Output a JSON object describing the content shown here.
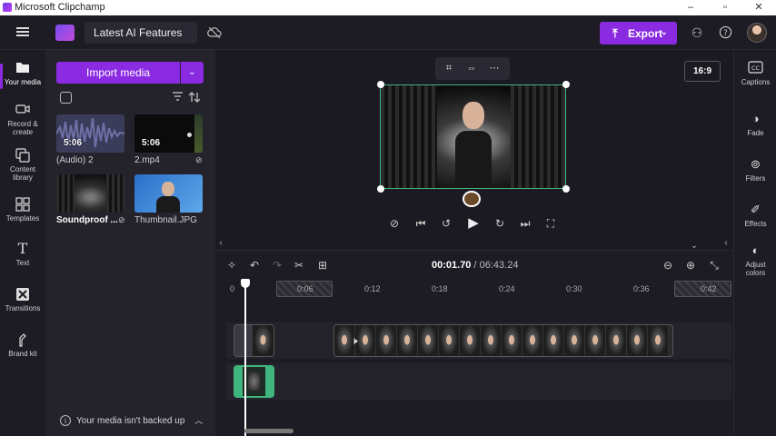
{
  "window": {
    "title": "Microsoft Clipchamp",
    "minimize": "‒",
    "maximize": "▫",
    "close": "✕"
  },
  "header": {
    "project_name": "Latest AI Features",
    "export_label": "Export",
    "export_chevron": "⌄",
    "icons": [
      "menu-icon",
      "cloud-off-icon",
      "upload-icon",
      "share-people-icon",
      "help-icon"
    ]
  },
  "leftnav": [
    {
      "label": "Your media",
      "icon": "folder-icon"
    },
    {
      "label": "Record & create",
      "icon": "camera-icon"
    },
    {
      "label": "Content library",
      "icon": "library-icon"
    },
    {
      "label": "Templates",
      "icon": "templates-icon"
    },
    {
      "label": "Text",
      "icon": "text-icon"
    },
    {
      "label": "Transitions",
      "icon": "transitions-icon"
    },
    {
      "label": "Brand kit",
      "icon": "brand-kit-icon"
    }
  ],
  "media": {
    "import_label": "Import media",
    "items": [
      {
        "name": "(Audio) 2",
        "duration": "5:06"
      },
      {
        "name": "2.mp4",
        "duration": "5:06"
      },
      {
        "name": "Soundproof ...",
        "duration": ""
      },
      {
        "name": "Thumbnail.JPG",
        "duration": ""
      }
    ],
    "backup_text": "Your media isn't backed up"
  },
  "preview": {
    "aspect_ratio": "16:9"
  },
  "rightpanel": [
    {
      "label": "Captions",
      "icon": "captions-icon"
    },
    {
      "label": "Fade",
      "icon": "fade-icon"
    },
    {
      "label": "Filters",
      "icon": "filters-icon"
    },
    {
      "label": "Effects",
      "icon": "effects-icon"
    },
    {
      "label": "Adjust colors",
      "icon": "adjust-colors-icon"
    }
  ],
  "timeline": {
    "current_time": "00:01.70",
    "separator": "/",
    "total_time": "06:43.24",
    "ticks": [
      "0",
      "0:06",
      "0:12",
      "0:18",
      "0:24",
      "0:30",
      "0:36",
      "0:42"
    ]
  },
  "colors": {
    "accent": "#8a2be2",
    "selection": "#3fb67d"
  }
}
